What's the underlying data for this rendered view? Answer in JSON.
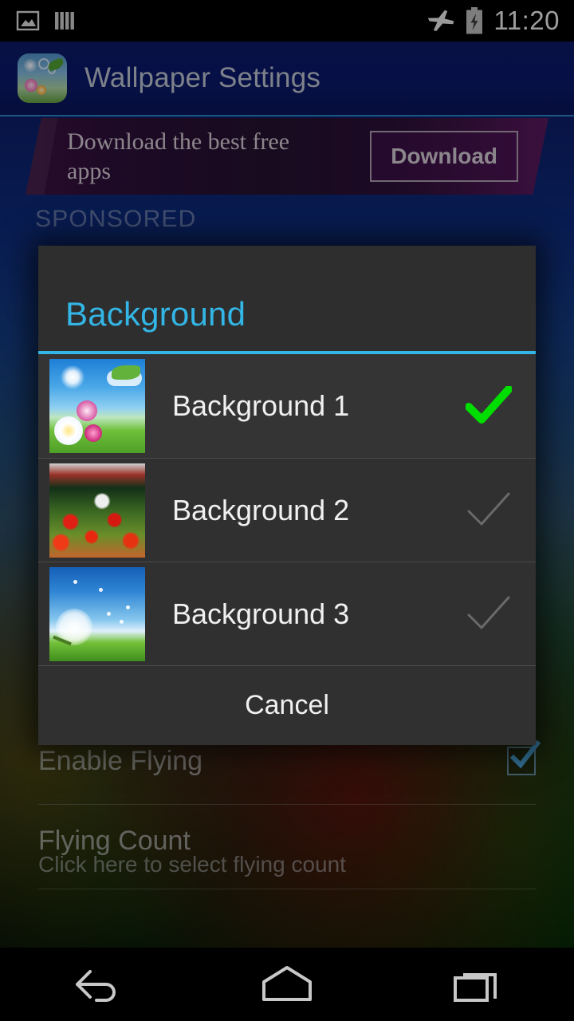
{
  "statusbar": {
    "icons": [
      "image-icon",
      "bars-icon"
    ],
    "right_icons": [
      "airplane-mode-icon",
      "battery-charging-icon"
    ],
    "clock": "11:20"
  },
  "actionbar": {
    "app_icon": "wallpaper-app-icon",
    "title": "Wallpaper Settings"
  },
  "ad": {
    "text": "Download the best free apps",
    "button_label": "Download",
    "sponsored_label": "SPONSORED"
  },
  "settings": {
    "items": [
      {
        "title": "Enable Flying",
        "subtitle": "",
        "checked": true
      },
      {
        "title": "Flying Count",
        "subtitle": "Click here to select flying count",
        "checked": false
      }
    ]
  },
  "dialog": {
    "title": "Background",
    "accent_color": "#33b5e5",
    "selected_color": "#00dd00",
    "items": [
      {
        "label": "Background 1",
        "thumb": "sunny-flowers-thumb",
        "selected": true
      },
      {
        "label": "Background 2",
        "thumb": "red-poppies-thumb",
        "selected": false
      },
      {
        "label": "Background 3",
        "thumb": "dandelion-thumb",
        "selected": false
      }
    ],
    "cancel_label": "Cancel"
  },
  "navbar": {
    "back": "back-icon",
    "home": "home-icon",
    "recents": "recents-icon"
  }
}
